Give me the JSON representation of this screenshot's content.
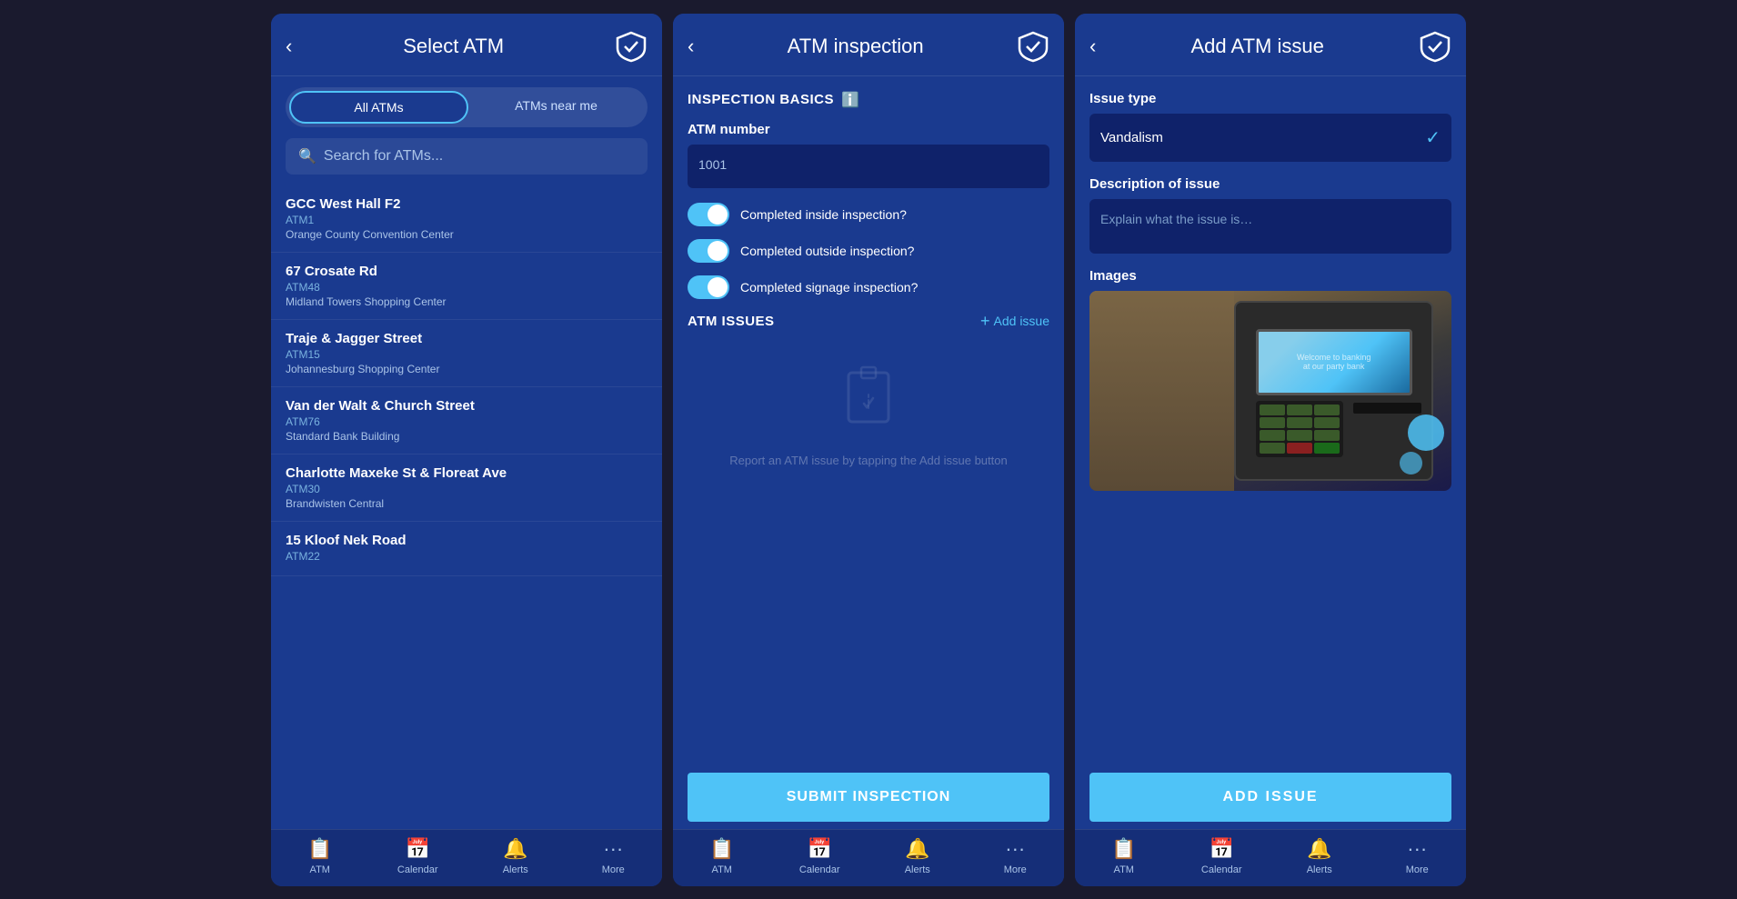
{
  "screen1": {
    "title": "Select ATM",
    "back_label": "‹",
    "tabs": [
      {
        "label": "All ATMs",
        "active": true
      },
      {
        "label": "ATMs near me",
        "active": false
      }
    ],
    "search_placeholder": "Search for ATMs...",
    "atm_items": [
      {
        "name": "GCC West Hall F2",
        "code": "ATM1",
        "location": "Orange County Convention Center"
      },
      {
        "name": "67 Crosate Rd",
        "code": "ATM48",
        "location": "Midland Towers Shopping Center"
      },
      {
        "name": "Traje & Jagger Street",
        "code": "ATM15",
        "location": "Johannesburg Shopping Center"
      },
      {
        "name": "Van der Walt & Church Street",
        "code": "ATM76",
        "location": "Standard Bank Building"
      },
      {
        "name": "Charlotte Maxeke St & Floreat Ave",
        "code": "ATM30",
        "location": "Brandwisten Central"
      },
      {
        "name": "15 Kloof Nek Road",
        "code": "ATM22",
        "location": ""
      }
    ],
    "nav": [
      {
        "icon": "📋",
        "label": "ATM"
      },
      {
        "icon": "📅",
        "label": "Calendar"
      },
      {
        "icon": "🔔",
        "label": "Alerts"
      },
      {
        "icon": "···",
        "label": "More"
      }
    ]
  },
  "screen2": {
    "title": "ATM inspection",
    "back_label": "‹",
    "section_inspection": "INSPECTION BASICS",
    "atm_number_label": "ATM number",
    "atm_number_value": "1001",
    "toggles": [
      {
        "label": "Completed inside inspection?",
        "on": true
      },
      {
        "label": "Completed outside inspection?",
        "on": true
      },
      {
        "label": "Completed signage inspection?",
        "on": true
      }
    ],
    "section_issues": "ATM ISSUES",
    "add_issue_label": "Add issue",
    "empty_text": "Report an ATM issue by\ntapping the Add issue button",
    "submit_label": "SUBMIT INSPECTION",
    "nav": [
      {
        "icon": "📋",
        "label": "ATM"
      },
      {
        "icon": "📅",
        "label": "Calendar"
      },
      {
        "icon": "🔔",
        "label": "Alerts"
      },
      {
        "icon": "···",
        "label": "More"
      }
    ]
  },
  "screen3": {
    "title": "Add ATM issue",
    "back_label": "‹",
    "issue_type_label": "Issue type",
    "issue_type_value": "Vandalism",
    "description_label": "Description of issue",
    "description_placeholder": "Explain what the issue is…",
    "images_label": "Images",
    "add_issue_button": "ADD ISSUE",
    "nav": [
      {
        "icon": "📋",
        "label": "ATM"
      },
      {
        "icon": "📅",
        "label": "Calendar"
      },
      {
        "icon": "🔔",
        "label": "Alerts"
      },
      {
        "icon": "···",
        "label": "More"
      }
    ]
  }
}
